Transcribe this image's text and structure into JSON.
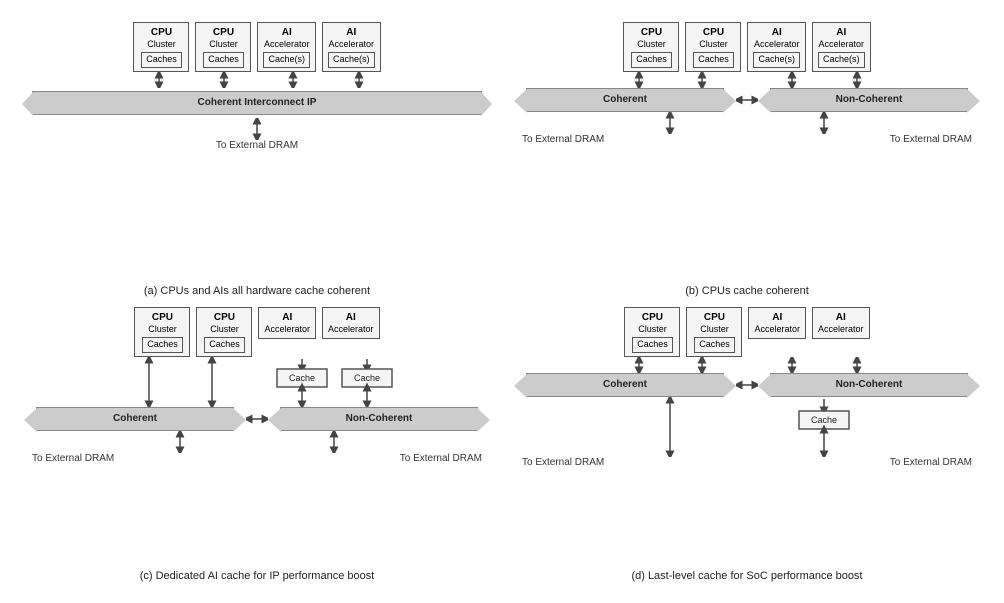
{
  "diagrams": {
    "a": {
      "caption": "(a) CPUs and AIs all hardware cache coherent",
      "nodes": [
        {
          "title": "CPU",
          "sub": "Cluster",
          "cache": "Caches"
        },
        {
          "title": "CPU",
          "sub": "Cluster",
          "cache": "Caches"
        },
        {
          "title": "AI",
          "sub": "Accelerator",
          "cache": "Cache(s)"
        },
        {
          "title": "AI",
          "sub": "Accelerator",
          "cache": "Cache(s)"
        }
      ],
      "banner": "Coherent Interconnect IP",
      "dram": "To External DRAM"
    },
    "b": {
      "caption": "(b) CPUs cache coherent",
      "nodes": [
        {
          "title": "CPU",
          "sub": "Cluster",
          "cache": "Caches"
        },
        {
          "title": "CPU",
          "sub": "Cluster",
          "cache": "Caches"
        },
        {
          "title": "AI",
          "sub": "Accelerator",
          "cache": "Cache(s)"
        },
        {
          "title": "AI",
          "sub": "Accelerator",
          "cache": "Cache(s)"
        }
      ],
      "bannerLeft": "Coherent",
      "bannerRight": "Non-Coherent",
      "dramLeft": "To External DRAM",
      "dramRight": "To External DRAM"
    },
    "c": {
      "caption": "(c) Dedicated AI cache for IP performance boost",
      "nodes": [
        {
          "title": "CPU",
          "sub": "Cluster",
          "cache": "Caches"
        },
        {
          "title": "CPU",
          "sub": "Cluster",
          "cache": "Caches"
        },
        {
          "title": "AI",
          "sub": "Accelerator",
          "cache": ""
        },
        {
          "title": "AI",
          "sub": "Accelerator",
          "cache": ""
        }
      ],
      "aiCache": "Cache",
      "bannerLeft": "Coherent",
      "bannerRight": "Non-Coherent",
      "dramLeft": "To External DRAM",
      "dramRight": "To External DRAM"
    },
    "d": {
      "caption": "(d) Last-level cache for SoC performance boost",
      "nodes": [
        {
          "title": "CPU",
          "sub": "Cluster",
          "cache": "Caches"
        },
        {
          "title": "CPU",
          "sub": "Cluster",
          "cache": "Caches"
        },
        {
          "title": "AI",
          "sub": "Accelerator",
          "cache": ""
        },
        {
          "title": "AI",
          "sub": "Accelerator",
          "cache": ""
        }
      ],
      "llcCache": "Cache",
      "bannerLeft": "Coherent",
      "bannerRight": "Non-Coherent",
      "dramLeft": "To External DRAM",
      "dramRight": "To External DRAM"
    }
  }
}
